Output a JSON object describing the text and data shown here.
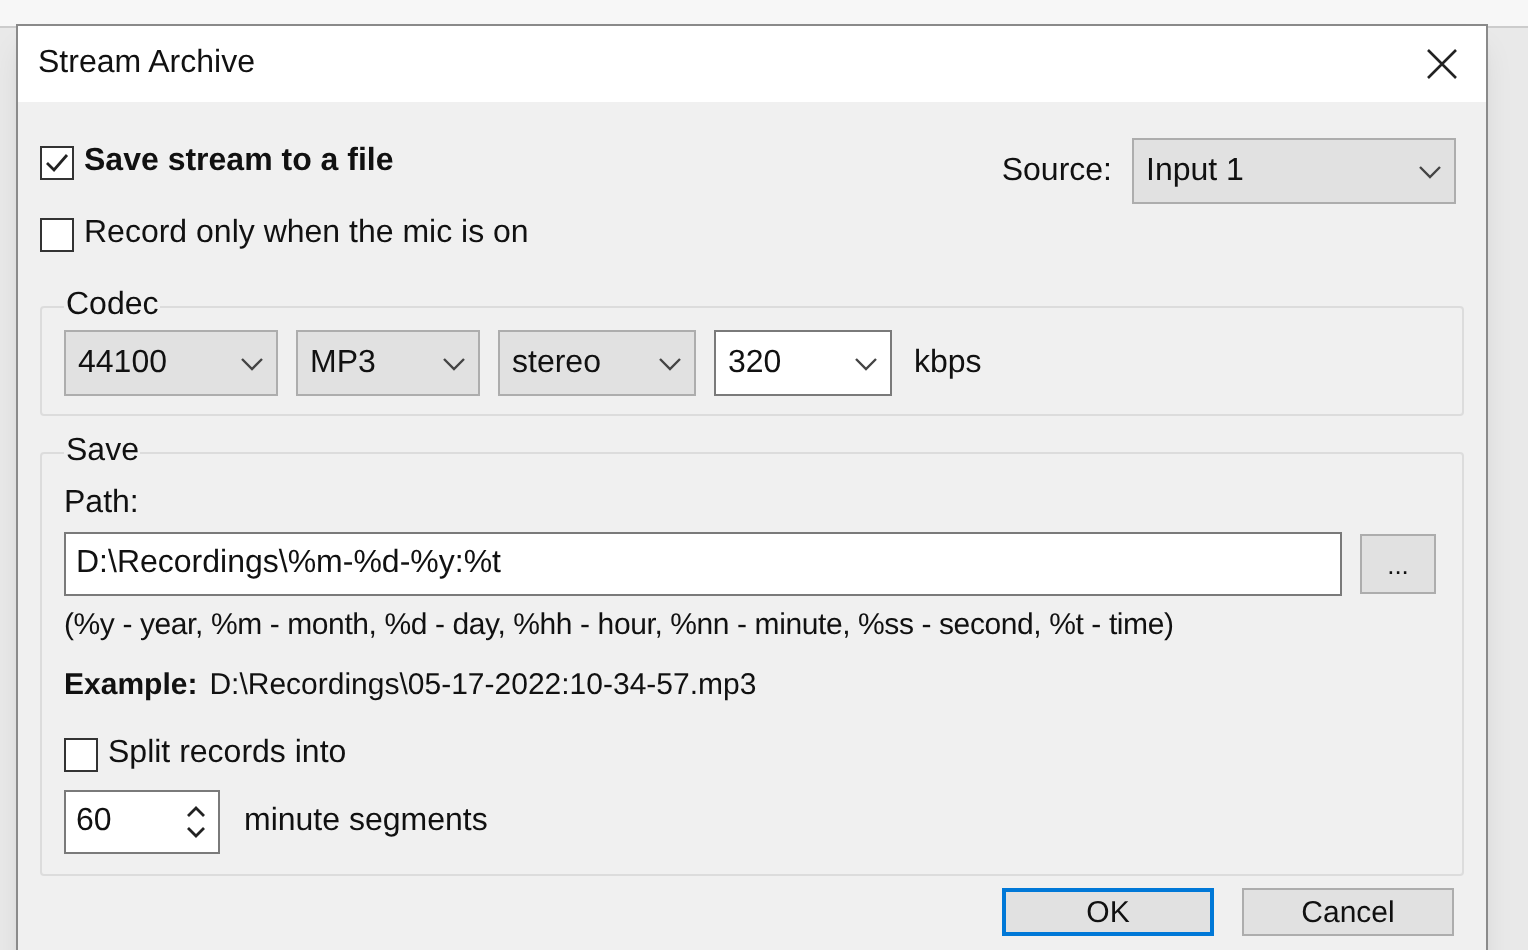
{
  "window": {
    "title": "Stream Archive"
  },
  "options": [
    {
      "label": "Save stream to a file",
      "checked": true,
      "bold": true
    },
    {
      "label": "Record only when the mic is on",
      "checked": false,
      "bold": false
    }
  ],
  "source": {
    "label": "Source:",
    "value": "Input 1"
  },
  "codec": {
    "title": "Codec",
    "fields": [
      {
        "kind": "dropdown",
        "value": "44100"
      },
      {
        "kind": "dropdown",
        "value": "MP3"
      },
      {
        "kind": "dropdown",
        "value": "stereo"
      },
      {
        "kind": "combo",
        "value": "320"
      }
    ],
    "unit": "kbps"
  },
  "save": {
    "title": "Save",
    "path_label": "Path:",
    "path_value": "D:\\Recordings\\%m-%d-%y:%t",
    "browse": "...",
    "hint": "(%y - year, %m - month, %d - day, %hh - hour, %nn - minute, %ss - second, %t - time)",
    "example_label": "Example:",
    "example_value": "D:\\Recordings\\05-17-2022:10-34-57.mp3",
    "split": {
      "label": "Split records into",
      "checked": false
    },
    "segment_value": "60",
    "segment_unit": "minute segments"
  },
  "buttons": [
    {
      "label": "OK",
      "default": true
    },
    {
      "label": "Cancel",
      "default": false
    }
  ]
}
